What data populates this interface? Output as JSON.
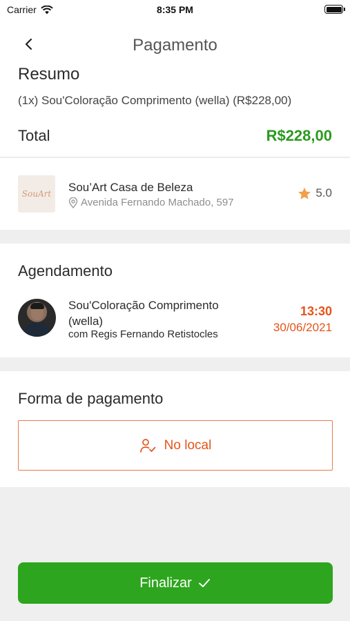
{
  "status_bar": {
    "carrier": "Carrier",
    "time": "8:35 PM"
  },
  "header": {
    "title": "Pagamento",
    "back_icon": "chevron-left-icon"
  },
  "resumo": {
    "title": "Resumo",
    "line": "(1x) Sou'Coloração  Comprimento (wella) (R$228,00)",
    "total_label": "Total",
    "total_value": "R$228,00"
  },
  "salon": {
    "logo_text": "SouArt",
    "name": "Sou’Art Casa de Beleza",
    "address": "Avenida Fernando Machado, 597",
    "rating": "5.0",
    "star_color": "#f0a04b"
  },
  "agendamento": {
    "title": "Agendamento",
    "service": "Sou'Coloração  Comprimento (wella)",
    "professional": "com Regis Fernando Retistocles",
    "time": "13:30",
    "date": "30/06/2021"
  },
  "pagamento": {
    "title": "Forma de pagamento",
    "option_label": "No local",
    "option_icon": "user-check-icon"
  },
  "footer": {
    "finalize_label": "Finalizar",
    "finalize_icon": "check-icon"
  },
  "colors": {
    "accent_orange": "#e5531a",
    "total_green": "#2b9a1f",
    "button_green": "#2ea51e"
  }
}
